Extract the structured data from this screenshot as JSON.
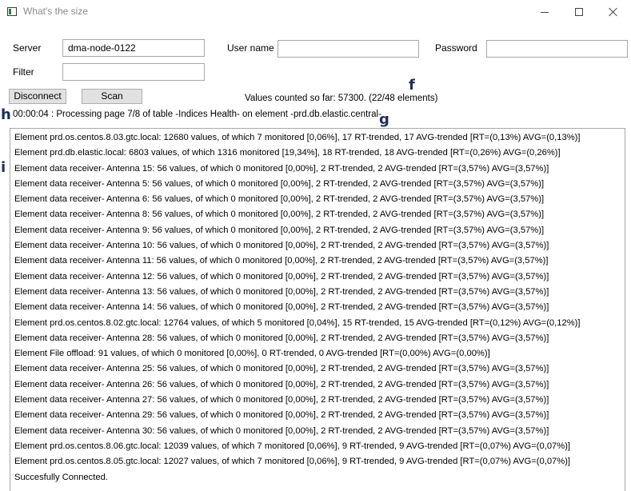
{
  "window": {
    "title": "What's the size"
  },
  "form": {
    "server_label": "Server",
    "server_value": "dma-node-0122",
    "username_label": "User name",
    "username_value": "",
    "password_label": "Password",
    "password_value": "",
    "filter_label": "Filter",
    "filter_value": ""
  },
  "buttons": {
    "disconnect": "Disconnect",
    "scan": "Scan"
  },
  "status": {
    "values_counted": "Values counted so far: 57300.  (22/48 elements)",
    "processing": "00:00:04 : Processing page 7/8 of table -Indices Health- on element -prd.db.elastic.central-"
  },
  "markers": {
    "f": "f",
    "g": "g",
    "h": "h",
    "i": "i"
  },
  "log": [
    "Element prd.os.centos.8.03.gtc.local: 12680 values, of which 7 monitored [0,06%], 17 RT-trended, 17 AVG-trended [RT=(0,13%) AVG=(0,13%)]",
    "Element prd.db.elastic.local: 6803 values, of which 1316 monitored [19,34%], 18 RT-trended, 18 AVG-trended [RT=(0,26%) AVG=(0,26%)]",
    "Element data receiver- Antenna 15: 56 values, of which 0 monitored [0,00%], 2 RT-trended, 2 AVG-trended [RT=(3,57%) AVG=(3,57%)]",
    "Element data receiver- Antenna 5: 56 values, of which 0 monitored [0,00%], 2 RT-trended, 2 AVG-trended [RT=(3,57%) AVG=(3,57%)]",
    "Element data receiver- Antenna 6: 56 values, of which 0 monitored [0,00%], 2 RT-trended, 2 AVG-trended [RT=(3,57%) AVG=(3,57%)]",
    "Element data receiver- Antenna 8: 56 values, of which 0 monitored [0,00%], 2 RT-trended, 2 AVG-trended [RT=(3,57%) AVG=(3,57%)]",
    "Element data receiver- Antenna 9: 56 values, of which 0 monitored [0,00%], 2 RT-trended, 2 AVG-trended [RT=(3,57%) AVG=(3,57%)]",
    "Element data receiver- Antenna 10: 56 values, of which 0 monitored [0,00%], 2 RT-trended, 2 AVG-trended [RT=(3,57%) AVG=(3,57%)]",
    "Element data receiver- Antenna 11: 56 values, of which 0 monitored [0,00%], 2 RT-trended, 2 AVG-trended [RT=(3,57%) AVG=(3,57%)]",
    "Element data receiver- Antenna 12: 56 values, of which 0 monitored [0,00%], 2 RT-trended, 2 AVG-trended [RT=(3,57%) AVG=(3,57%)]",
    "Element data receiver- Antenna 13: 56 values, of which 0 monitored [0,00%], 2 RT-trended, 2 AVG-trended [RT=(3,57%) AVG=(3,57%)]",
    "Element data receiver- Antenna 14: 56 values, of which 0 monitored [0,00%], 2 RT-trended, 2 AVG-trended [RT=(3,57%) AVG=(3,57%)]",
    "Element prd.os.centos.8.02.gtc.local: 12764 values, of which 5 monitored [0,04%], 15 RT-trended, 15 AVG-trended [RT=(0,12%) AVG=(0,12%)]",
    "Element data receiver- Antenna 28: 56 values, of which 0 monitored [0,00%], 2 RT-trended, 2 AVG-trended [RT=(3,57%) AVG=(3,57%)]",
    "Element File offload: 91 values, of which 0 monitored [0,00%], 0 RT-trended, 0 AVG-trended [RT=(0,00%) AVG=(0,00%)]",
    "Element data receiver- Antenna 25: 56 values, of which 0 monitored [0,00%], 2 RT-trended, 2 AVG-trended [RT=(3,57%) AVG=(3,57%)]",
    "Element data receiver- Antenna 26: 56 values, of which 0 monitored [0,00%], 2 RT-trended, 2 AVG-trended [RT=(3,57%) AVG=(3,57%)]",
    "Element data receiver- Antenna 27: 56 values, of which 0 monitored [0,00%], 2 RT-trended, 2 AVG-trended [RT=(3,57%) AVG=(3,57%)]",
    "Element data receiver- Antenna 29: 56 values, of which 0 monitored [0,00%], 2 RT-trended, 2 AVG-trended [RT=(3,57%) AVG=(3,57%)]",
    "Element data receiver- Antenna 30: 56 values, of which 0 monitored [0,00%], 2 RT-trended, 2 AVG-trended [RT=(3,57%) AVG=(3,57%)]",
    "Element prd.os.centos.8.06.gtc.local: 12039 values, of which 7 monitored [0,06%], 9 RT-trended, 9 AVG-trended [RT=(0,07%) AVG=(0,07%)]",
    "Element prd.os.centos.8.05.gtc.local: 12027 values, of which 7 monitored [0,06%], 9 RT-trended, 9 AVG-trended [RT=(0,07%) AVG=(0,07%)]",
    "Succesfully Connected."
  ]
}
